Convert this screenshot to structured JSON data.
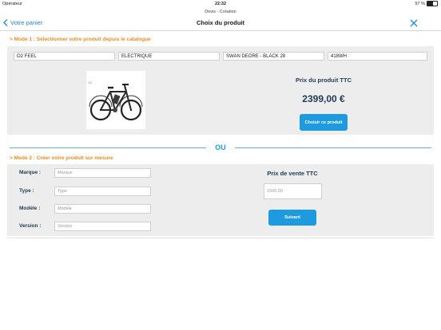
{
  "status_bar": {
    "carrier": "Opérateur",
    "time": "22:32",
    "battery_text": "57 %",
    "battery_level": 0.57
  },
  "nav": {
    "subtitle": "Devis - Création",
    "title": "Choix du produit",
    "back_label": "Votre panier",
    "close_icon": "close-icon"
  },
  "mode1": {
    "title": "> Mode 1 : Sélectionner votre produit depuis le catalogue",
    "fields": [
      "O2 FEEL",
      "ELECTRIQUE",
      "SWAN DEORE - BLACK 28",
      "418WH"
    ],
    "image_icon": "electric-bike-image",
    "price_label": "Prix du produit TTC",
    "price": "2399,00 €",
    "choose_button": "Choisir ce produit"
  },
  "separator": {
    "text": "OU"
  },
  "mode2": {
    "title": "> Mode 2 : Créer votre produit sur mesure",
    "rows": [
      {
        "label": "Marque :",
        "placeholder": "Marque"
      },
      {
        "label": "Type :",
        "placeholder": "Type"
      },
      {
        "label": "Modèle :",
        "placeholder": "Modèle"
      },
      {
        "label": "Version :",
        "placeholder": "Version"
      }
    ],
    "price_label": "Prix de vente TTC",
    "price_placeholder": "1500,00",
    "next_button": "Suivant"
  },
  "colors": {
    "accent": "#1e9ae0",
    "orange": "#f08a1c",
    "panel": "#ededed",
    "label": "#1f3a57"
  }
}
